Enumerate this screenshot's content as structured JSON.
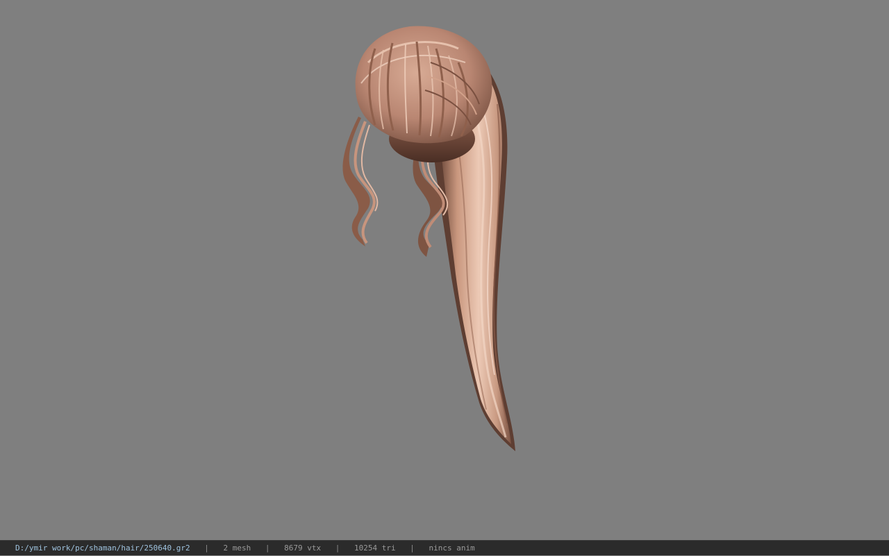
{
  "viewport": {
    "background_color": "#7f7f7f",
    "model_description_icon": "hair-mesh-icon"
  },
  "statusbar": {
    "file_path": "D:/ymir work/pc/shaman/hair/250640.gr2",
    "mesh_count": "2 mesh",
    "vertex_count": "8679 vtx",
    "triangle_count": "10254 tri",
    "anim_status": "nincs anim",
    "separator": "|"
  },
  "colors": {
    "hair_base": "#b98a74",
    "hair_light": "#e6c2ae",
    "hair_dark": "#6a4638",
    "statusbar_bg": "#2b2b2b",
    "path_text": "#9fc3df"
  }
}
